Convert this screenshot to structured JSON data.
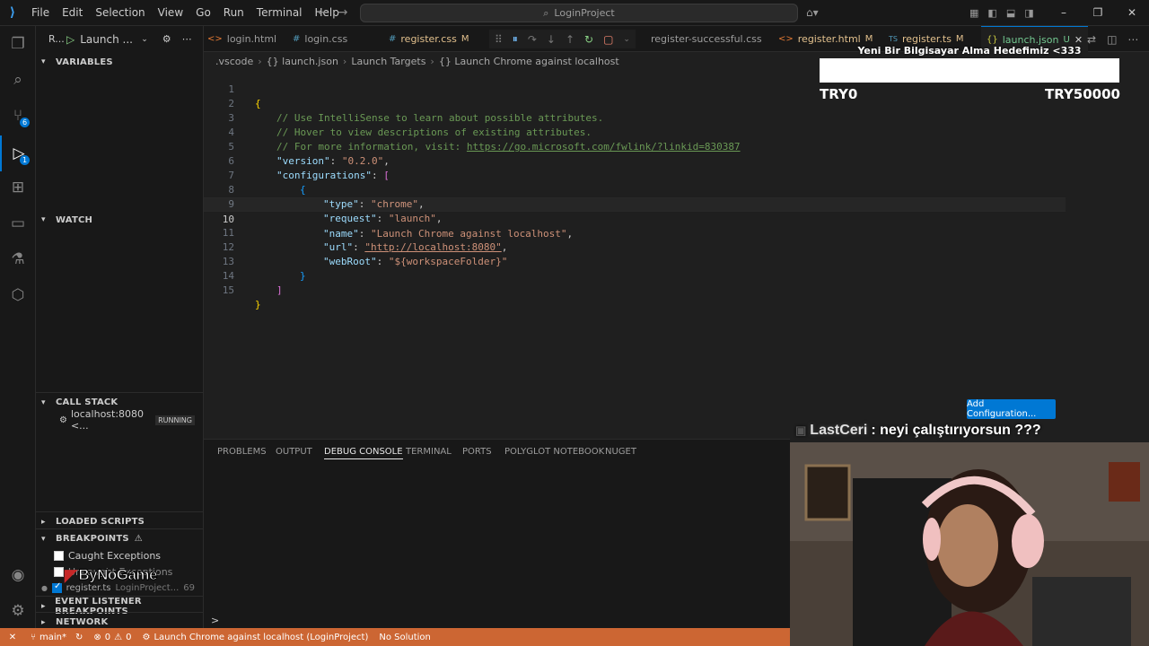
{
  "titlebar": {
    "menu": [
      "File",
      "Edit",
      "Selection",
      "View",
      "Go",
      "Run",
      "Terminal",
      "Help"
    ],
    "search": "LoginProject"
  },
  "debug": {
    "run_label": "R...",
    "config_label": "Launch ..."
  },
  "sidebar": {
    "variables": "VARIABLES",
    "watch": "WATCH",
    "callstack": "CALL STACK",
    "callstack_item": "localhost:8080 <...",
    "callstack_status": "RUNNING",
    "loaded_scripts": "LOADED SCRIPTS",
    "breakpoints": "BREAKPOINTS",
    "bp_caught": "Caught Exceptions",
    "bp_uncaught": "Uncaught Exceptions",
    "bp_register": "register.ts",
    "bp_register_path": "LoginProject...",
    "bp_register_line": "69",
    "event_listener": "EVENT LISTENER BREAKPOINTS",
    "network": "NETWORK"
  },
  "tabs": [
    {
      "label": "login.html",
      "icon": "<>",
      "mod": ""
    },
    {
      "label": "login.css",
      "icon": "#",
      "mod": ""
    },
    {
      "label": "register.css",
      "icon": "#",
      "mod": "M"
    },
    {
      "label": "register-successful.css",
      "icon": "",
      "mod": ""
    },
    {
      "label": "register.html",
      "icon": "<>",
      "mod": "M"
    },
    {
      "label": "register.ts",
      "icon": "TS",
      "mod": "M"
    },
    {
      "label": "launch.json",
      "icon": "{}",
      "mod": "U"
    }
  ],
  "breadcrumb": [
    ".vscode",
    "{} launch.json",
    "Launch Targets",
    "{} Launch Chrome against localhost"
  ],
  "editor": {
    "line_numbers": [
      "1",
      "2",
      "3",
      "4",
      "5",
      "6",
      "7",
      "8",
      "9",
      "10",
      "11",
      "12",
      "13",
      "14",
      "15"
    ],
    "comments": [
      "// Use IntelliSense to learn about possible attributes.",
      "// Hover to view descriptions of existing attributes.",
      "// For more information, visit: "
    ],
    "link": "https://go.microsoft.com/fwlink/?linkid=830387",
    "version_key": "\"version\"",
    "version_val": "\"0.2.0\"",
    "configs_key": "\"configurations\"",
    "type_key": "\"type\"",
    "type_val": "\"chrome\"",
    "request_key": "\"request\"",
    "request_val": "\"launch\"",
    "name_key": "\"name\"",
    "name_val": "\"Launch Chrome against localhost\"",
    "url_key": "\"url\"",
    "url_val": "\"http://localhost:8080\"",
    "webroot_key": "\"webRoot\"",
    "webroot_val": "\"${workspaceFolder}\""
  },
  "add_config": "Add Configuration...",
  "overlay": {
    "goal_title": "Yeni Bir Bilgisayar Alma Hedefimiz <333",
    "goal_min": "TRY0",
    "goal_max": "TRY50000",
    "goal_progress": 0,
    "chat_user": "LastCeri",
    "chat_text": ": neyi çalıştırıyorsun ???",
    "stream_logo": "ByNoGame"
  },
  "panel": {
    "tabs": [
      "PROBLEMS",
      "OUTPUT",
      "DEBUG CONSOLE",
      "TERMINAL",
      "PORTS",
      "POLYGLOT NOTEBOOK",
      "NUGET"
    ],
    "prompt": ">"
  },
  "statusbar": {
    "branch": "main*",
    "errors": "0",
    "warnings": "0",
    "debug_target": "Launch Chrome against localhost (LoginProject)",
    "solution": "No Solution"
  },
  "colors": {
    "accent": "#0078d4",
    "statusbar": "#cc6633",
    "editor_bg": "#1f1f1f"
  }
}
